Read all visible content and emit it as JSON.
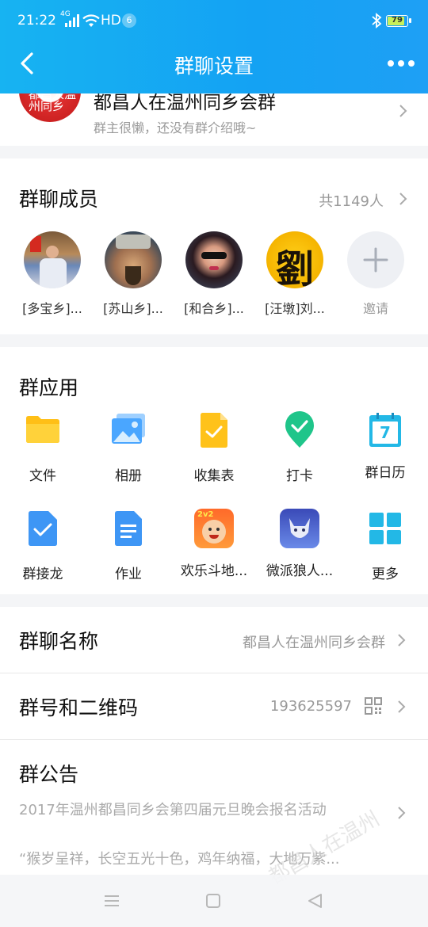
{
  "status_bar": {
    "time": "21:22",
    "network": "4G",
    "hd": "HD",
    "notification_count": "6",
    "battery": "79"
  },
  "header": {
    "title": "群聊设置"
  },
  "group": {
    "name": "都昌人在温州同乡会群",
    "description": "群主很懒，还没有群介绍哦~",
    "avatar_text": "都昌人温州同乡"
  },
  "members": {
    "title": "群聊成员",
    "count": "共1149人",
    "list": [
      {
        "name": "[多宝乡]..."
      },
      {
        "name": "[苏山乡]..."
      },
      {
        "name": "[和合乡]..."
      },
      {
        "name": "[汪墩]刘..."
      }
    ],
    "invite_label": "邀请",
    "liu_glyph": "劉"
  },
  "apps": {
    "title": "群应用",
    "items": [
      {
        "label": "文件",
        "icon": "folder-icon"
      },
      {
        "label": "相册",
        "icon": "photo-album-icon"
      },
      {
        "label": "收集表",
        "icon": "collection-form-icon"
      },
      {
        "label": "打卡",
        "icon": "checkin-icon"
      },
      {
        "label": "群日历",
        "icon": "calendar-icon"
      },
      {
        "label": "群接龙",
        "icon": "relay-icon"
      },
      {
        "label": "作业",
        "icon": "homework-icon"
      },
      {
        "label": "欢乐斗地...",
        "icon": "game-doudizhu-icon"
      },
      {
        "label": "微派狼人...",
        "icon": "game-werewolf-icon"
      },
      {
        "label": "更多",
        "icon": "more-apps-icon"
      }
    ],
    "calendar_day": "7",
    "game_badge": "2v2"
  },
  "settings": {
    "group_name_label": "群聊名称",
    "group_name_value": "都昌人在温州同乡会群",
    "group_id_label": "群号和二维码",
    "group_id_value": "193625597",
    "notice_label": "群公告",
    "notice_title": "2017年温州都昌同乡会第四届元旦晚会报名活动",
    "notice_preview": "“猴岁呈祥，长空五光十色，鸡年纳福，大地万紫..."
  },
  "watermark": "都昌人在温州",
  "colors": {
    "header_start": "#17b3f2",
    "header_end": "#1ea0f5",
    "accent_green": "#1fc58a",
    "folder_yellow": "#ffc21a"
  }
}
